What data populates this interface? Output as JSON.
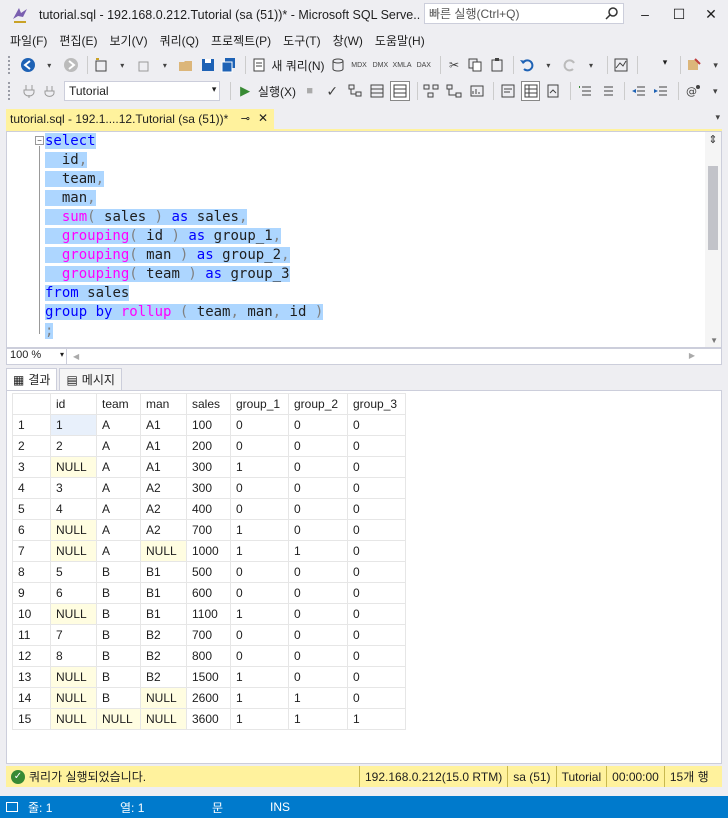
{
  "window": {
    "title": "tutorial.sql - 192.168.0.212.Tutorial (sa (51))* - Microsoft SQL Serve...",
    "quick_launch_placeholder": "빠른 실행(Ctrl+Q)"
  },
  "menu": [
    "파일(F)",
    "편집(E)",
    "보기(V)",
    "쿼리(Q)",
    "프로젝트(P)",
    "도구(T)",
    "창(W)",
    "도움말(H)"
  ],
  "toolbar": {
    "new_query": "새 쿼리(N)",
    "database": "Tutorial",
    "execute": "실행(X)"
  },
  "doc_tab": {
    "label": "tutorial.sql - 192.1....12.Tutorial (sa (51))*"
  },
  "editor": {
    "zoom": "100 %"
  },
  "results_tabs": {
    "results": "결과",
    "messages": "메시지"
  },
  "grid": {
    "columns": [
      "id",
      "team",
      "man",
      "sales",
      "group_1",
      "group_2",
      "group_3"
    ],
    "rows": [
      [
        "1",
        "1",
        "A",
        "A1",
        "100",
        "0",
        "0",
        "0"
      ],
      [
        "2",
        "2",
        "A",
        "A1",
        "200",
        "0",
        "0",
        "0"
      ],
      [
        "3",
        "NULL",
        "A",
        "A1",
        "300",
        "1",
        "0",
        "0"
      ],
      [
        "4",
        "3",
        "A",
        "A2",
        "300",
        "0",
        "0",
        "0"
      ],
      [
        "5",
        "4",
        "A",
        "A2",
        "400",
        "0",
        "0",
        "0"
      ],
      [
        "6",
        "NULL",
        "A",
        "A2",
        "700",
        "1",
        "0",
        "0"
      ],
      [
        "7",
        "NULL",
        "A",
        "NULL",
        "1000",
        "1",
        "1",
        "0"
      ],
      [
        "8",
        "5",
        "B",
        "B1",
        "500",
        "0",
        "0",
        "0"
      ],
      [
        "9",
        "6",
        "B",
        "B1",
        "600",
        "0",
        "0",
        "0"
      ],
      [
        "10",
        "NULL",
        "B",
        "B1",
        "1100",
        "1",
        "0",
        "0"
      ],
      [
        "11",
        "7",
        "B",
        "B2",
        "700",
        "0",
        "0",
        "0"
      ],
      [
        "12",
        "8",
        "B",
        "B2",
        "800",
        "0",
        "0",
        "0"
      ],
      [
        "13",
        "NULL",
        "B",
        "B2",
        "1500",
        "1",
        "0",
        "0"
      ],
      [
        "14",
        "NULL",
        "B",
        "NULL",
        "2600",
        "1",
        "1",
        "0"
      ],
      [
        "15",
        "NULL",
        "NULL",
        "NULL",
        "3600",
        "1",
        "1",
        "1"
      ]
    ]
  },
  "status": {
    "message": "쿼리가 실행되었습니다.",
    "server": "192.168.0.212(15.0 RTM)",
    "user": "sa (51)",
    "database": "Tutorial",
    "elapsed": "00:00:00",
    "rows": "15개 행"
  },
  "bottom": {
    "line": "줄: 1",
    "col": "열: 1",
    "char": "문",
    "mode": "INS"
  },
  "colors": {
    "accent_blue": "#007acc",
    "tab_yellow": "#fff29d",
    "selection": "#add6ff"
  }
}
